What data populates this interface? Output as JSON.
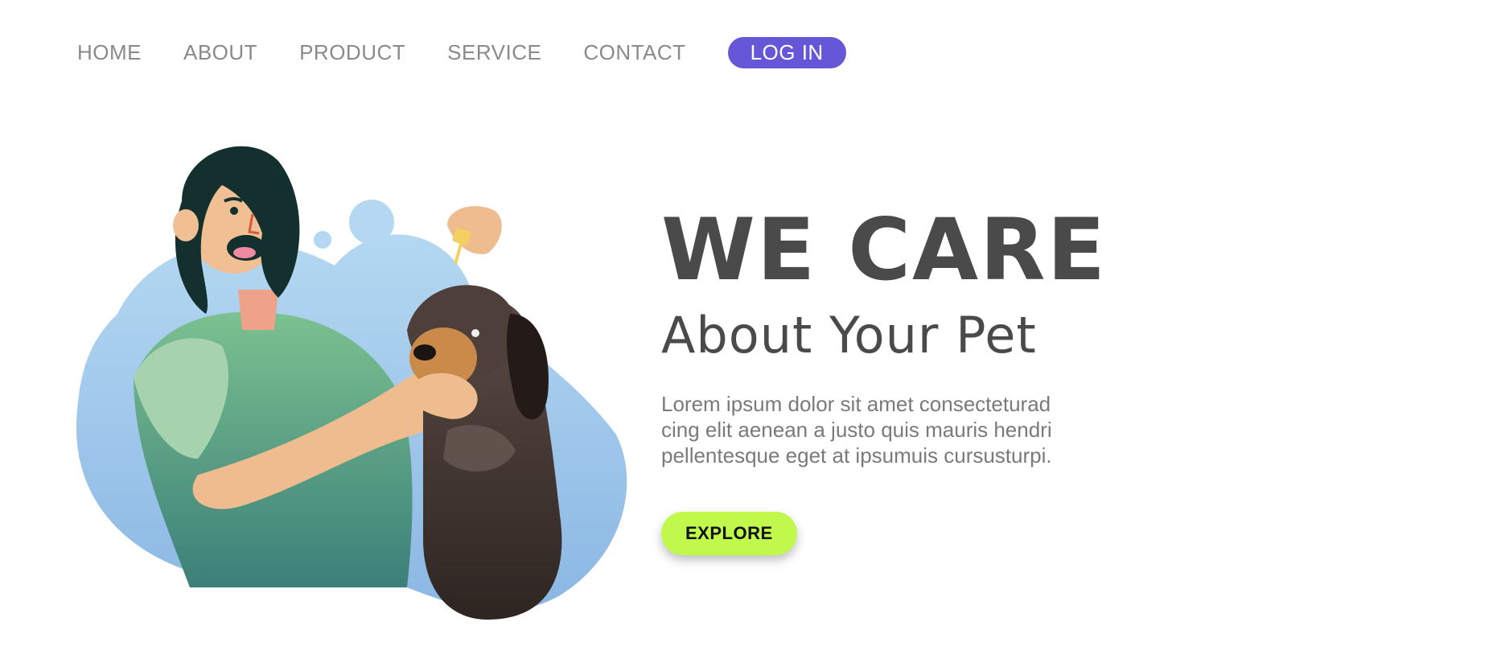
{
  "nav": {
    "items": [
      {
        "label": "HOME"
      },
      {
        "label": "ABOUT"
      },
      {
        "label": "PRODUCT"
      },
      {
        "label": "SERVICE"
      },
      {
        "label": "CONTACT"
      }
    ],
    "login_label": "LOG IN"
  },
  "hero": {
    "title": "WE CARE",
    "subtitle": "About Your Pet",
    "body_lines": [
      "Lorem ipsum dolor sit amet consecteturad",
      "cing elit aenean a justo quis mauris hendri",
      "pellentesque eget at ipsumuis cursusturpi."
    ],
    "cta_label": "EXPLORE"
  },
  "colors": {
    "accent": "#6656d8",
    "cta": "#c0f94b",
    "heading": "#4a4a4a",
    "nav_text": "#8a8a8a"
  },
  "illustration": {
    "icons": [
      "woman-icon",
      "dog-icon",
      "dropper-icon",
      "blob-background"
    ]
  }
}
